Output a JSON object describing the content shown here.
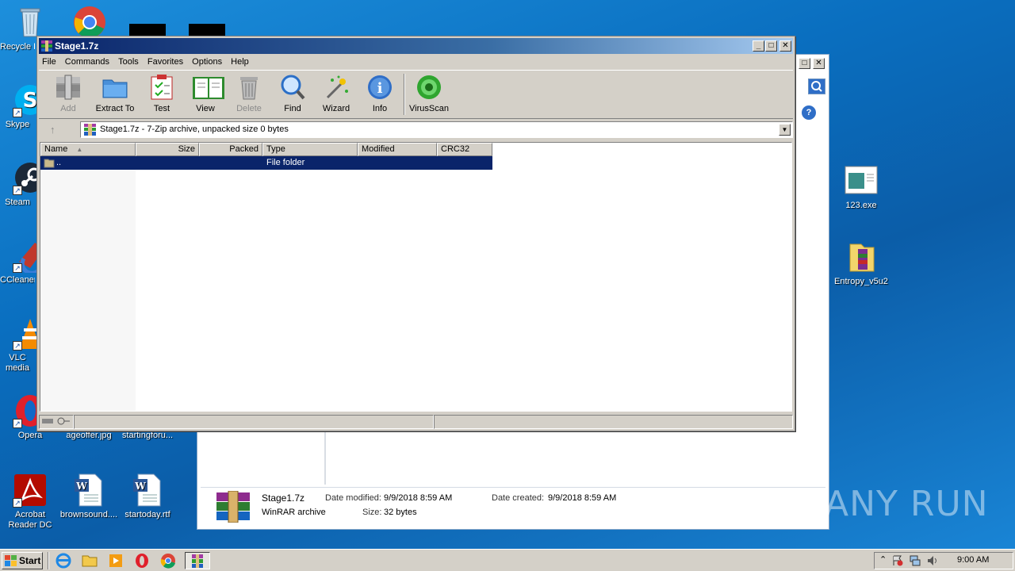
{
  "desktop": {
    "icons": [
      {
        "label": "Recycle Bin",
        "icon": "recycle-bin-icon"
      },
      {
        "label": "Skype",
        "icon": "skype-icon"
      },
      {
        "label": "Steam",
        "icon": "steam-icon"
      },
      {
        "label": "CCleaner",
        "icon": "ccleaner-icon"
      },
      {
        "label": "VLC media player",
        "icon": "vlc-icon"
      },
      {
        "label": "Opera",
        "icon": "opera-icon"
      },
      {
        "label": "Acrobat Reader DC",
        "icon": "acrobat-icon"
      },
      {
        "label": "ageoffer.jpg",
        "icon": "image-file-icon"
      },
      {
        "label": "startingforu...",
        "icon": "file-icon"
      },
      {
        "label": "brownsound....",
        "icon": "word-doc-icon"
      },
      {
        "label": "startoday.rtf",
        "icon": "word-doc-icon"
      },
      {
        "label": "123.exe",
        "icon": "exe-icon"
      },
      {
        "label": "Entropy_v5u2",
        "icon": "folder-icon"
      }
    ]
  },
  "winrar": {
    "title": "Stage1.7z",
    "menu": [
      "File",
      "Commands",
      "Tools",
      "Favorites",
      "Options",
      "Help"
    ],
    "toolbar": [
      {
        "label": "Add",
        "icon": "add-archive-icon",
        "enabled": false
      },
      {
        "label": "Extract To",
        "icon": "extract-folder-icon",
        "enabled": true
      },
      {
        "label": "Test",
        "icon": "test-clipboard-icon",
        "enabled": true
      },
      {
        "label": "View",
        "icon": "view-book-icon",
        "enabled": true
      },
      {
        "label": "Delete",
        "icon": "trash-icon",
        "enabled": false
      },
      {
        "label": "Find",
        "icon": "magnifier-icon",
        "enabled": true
      },
      {
        "label": "Wizard",
        "icon": "wand-icon",
        "enabled": true
      },
      {
        "label": "Info",
        "icon": "info-icon",
        "enabled": true
      },
      {
        "label": "VirusScan",
        "icon": "virus-scan-icon",
        "enabled": true
      }
    ],
    "address": "Stage1.7z - 7-Zip archive, unpacked size 0 bytes",
    "columns": [
      "Name",
      "Size",
      "Packed",
      "Type",
      "Modified",
      "CRC32"
    ],
    "rows": [
      {
        "name": "..",
        "size": "",
        "packed": "",
        "type": "File folder",
        "modified": "",
        "crc32": ""
      }
    ]
  },
  "explorer_details": {
    "filename": "Stage1.7z",
    "filetype": "WinRAR archive",
    "date_modified_label": "Date modified:",
    "date_modified": "9/9/2018 8:59 AM",
    "date_created_label": "Date created:",
    "date_created": "9/9/2018 8:59 AM",
    "size_label": "Size:",
    "size": "32 bytes"
  },
  "taskbar": {
    "start_label": "Start",
    "clock": "9:00 AM"
  },
  "watermark": "ANY RUN"
}
